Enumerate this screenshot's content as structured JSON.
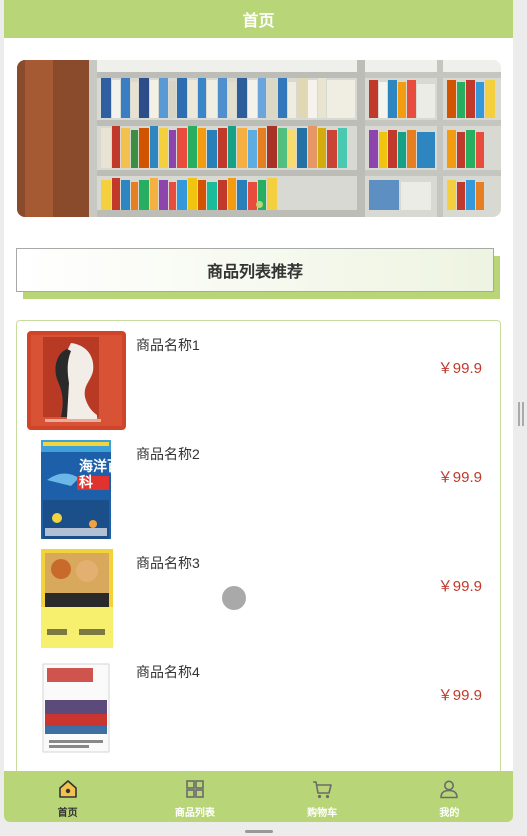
{
  "header": {
    "title": "首页"
  },
  "section": {
    "title": "商品列表推荐"
  },
  "products": [
    {
      "name": "商品名称1",
      "price": "￥99.9"
    },
    {
      "name": "商品名称2",
      "price": "￥99.9"
    },
    {
      "name": "商品名称3",
      "price": "￥99.9"
    },
    {
      "name": "商品名称4",
      "price": "￥99.9"
    }
  ],
  "product_covers": [
    {
      "title": "",
      "colors": [
        "#c9452c",
        "#e06a45",
        "#f4f0ea",
        "#2a2a2a"
      ]
    },
    {
      "title": "海洋百科",
      "colors": [
        "#1d5fa8",
        "#3ea0d8",
        "#e0332f",
        "#f2d43d"
      ]
    },
    {
      "title": "柳林风声",
      "colors": [
        "#f3d33a",
        "#f7ef6e",
        "#2a2a2a",
        "#c86b2a"
      ]
    },
    {
      "title": "老相生活",
      "colors": [
        "#ffffff",
        "#c8362f",
        "#5c4b7a",
        "#3d6fa5"
      ]
    }
  ],
  "tabbar": {
    "items": [
      {
        "label": "首页",
        "icon": "home-icon",
        "active": true
      },
      {
        "label": "商品列表",
        "icon": "grid-icon",
        "active": false
      },
      {
        "label": "购物车",
        "icon": "cart-icon",
        "active": false
      },
      {
        "label": "我的",
        "icon": "user-icon",
        "active": false
      }
    ]
  },
  "theme": {
    "accent": "#b8d677",
    "price": "#c0392b",
    "text": "#333333"
  }
}
